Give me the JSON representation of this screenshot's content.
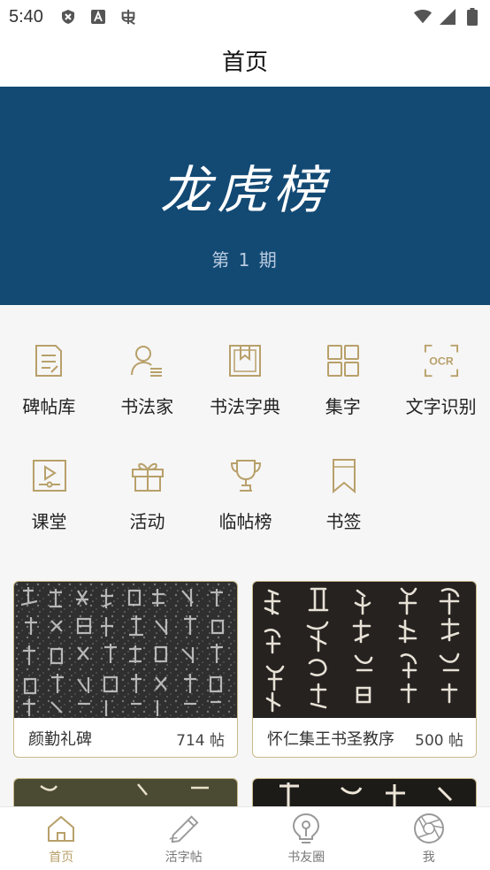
{
  "status_bar": {
    "time": "5:40"
  },
  "header": {
    "title": "首页"
  },
  "banner": {
    "title": "龙虎榜",
    "issue": "第 1 期",
    "background": "#134a74"
  },
  "accent_color": "#b8a06a",
  "features": {
    "row1": [
      {
        "label": "碑帖库",
        "icon": "document-icon"
      },
      {
        "label": "书法家",
        "icon": "person-list-icon"
      },
      {
        "label": "书法字典",
        "icon": "dictionary-icon"
      },
      {
        "label": "集字",
        "icon": "grid-icon"
      },
      {
        "label": "文字识别",
        "icon": "ocr-icon"
      }
    ],
    "row2": [
      {
        "label": "课堂",
        "icon": "video-icon"
      },
      {
        "label": "活动",
        "icon": "gift-icon"
      },
      {
        "label": "临帖榜",
        "icon": "trophy-icon"
      },
      {
        "label": "书签",
        "icon": "bookmark-icon"
      }
    ]
  },
  "cards": [
    {
      "name": "颜勤礼碑",
      "count": "714 帖"
    },
    {
      "name": "怀仁集王书圣教序",
      "count": "500 帖"
    }
  ],
  "tabs": [
    {
      "label": "首页",
      "icon": "home-icon",
      "active": true
    },
    {
      "label": "活字帖",
      "icon": "pen-icon",
      "active": false
    },
    {
      "label": "书友圈",
      "icon": "bulb-icon",
      "active": false
    },
    {
      "label": "我",
      "icon": "aperture-icon",
      "active": false
    }
  ]
}
